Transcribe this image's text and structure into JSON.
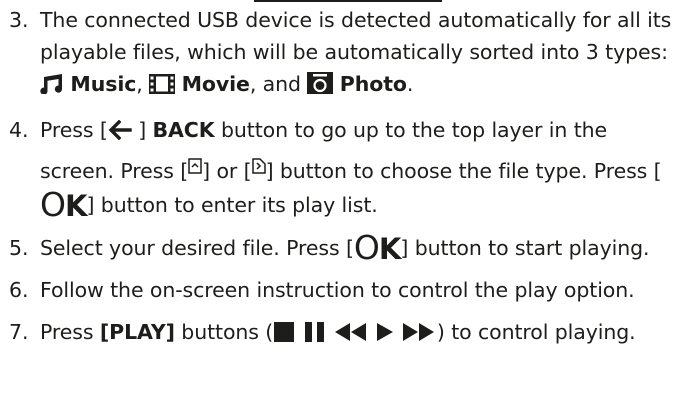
{
  "steps": [
    {
      "num": "3.",
      "part1": "The connected USB device is detected automatically for all its playable files, which will be automatically sorted into 3 types: ",
      "music": "Music",
      "sep1": ", ",
      "movie": "Movie",
      "sep2": ", and ",
      "photo": "Photo",
      "end": "."
    },
    {
      "num": "4.",
      "press1": "Press [",
      "back_bracket": " ] ",
      "back": "BACK",
      "text1": " button to go up to the top layer in the screen. Press [",
      "or": "] or [",
      "text2": "] button to choose the file type. Press [",
      "ok_o": "O",
      "ok_k": "K",
      "text3": "] button to enter its play list."
    },
    {
      "num": "5.",
      "text1": "Select your desired file. Press [",
      "ok_o": "O",
      "ok_k": "K",
      "text2": "] button to start playing."
    },
    {
      "num": "6.",
      "text": "Follow the on-screen instruction to control the play option."
    },
    {
      "num": "7.",
      "text1": "Press ",
      "play": "[PLAY]",
      "text2": " buttons (",
      "text3": ") to control playing."
    }
  ],
  "icons": {
    "music": "music-note-icon",
    "movie": "film-strip-icon",
    "photo": "camera-icon",
    "back": "left-arrow-icon",
    "prev_page": "page-up-icon",
    "next_page": "page-down-icon",
    "stop": "stop-icon",
    "pause": "pause-icon",
    "rewind": "rewind-icon",
    "play": "play-icon",
    "fast_forward": "fast-forward-icon"
  },
  "colors": {
    "text": "#1d1d1b"
  }
}
